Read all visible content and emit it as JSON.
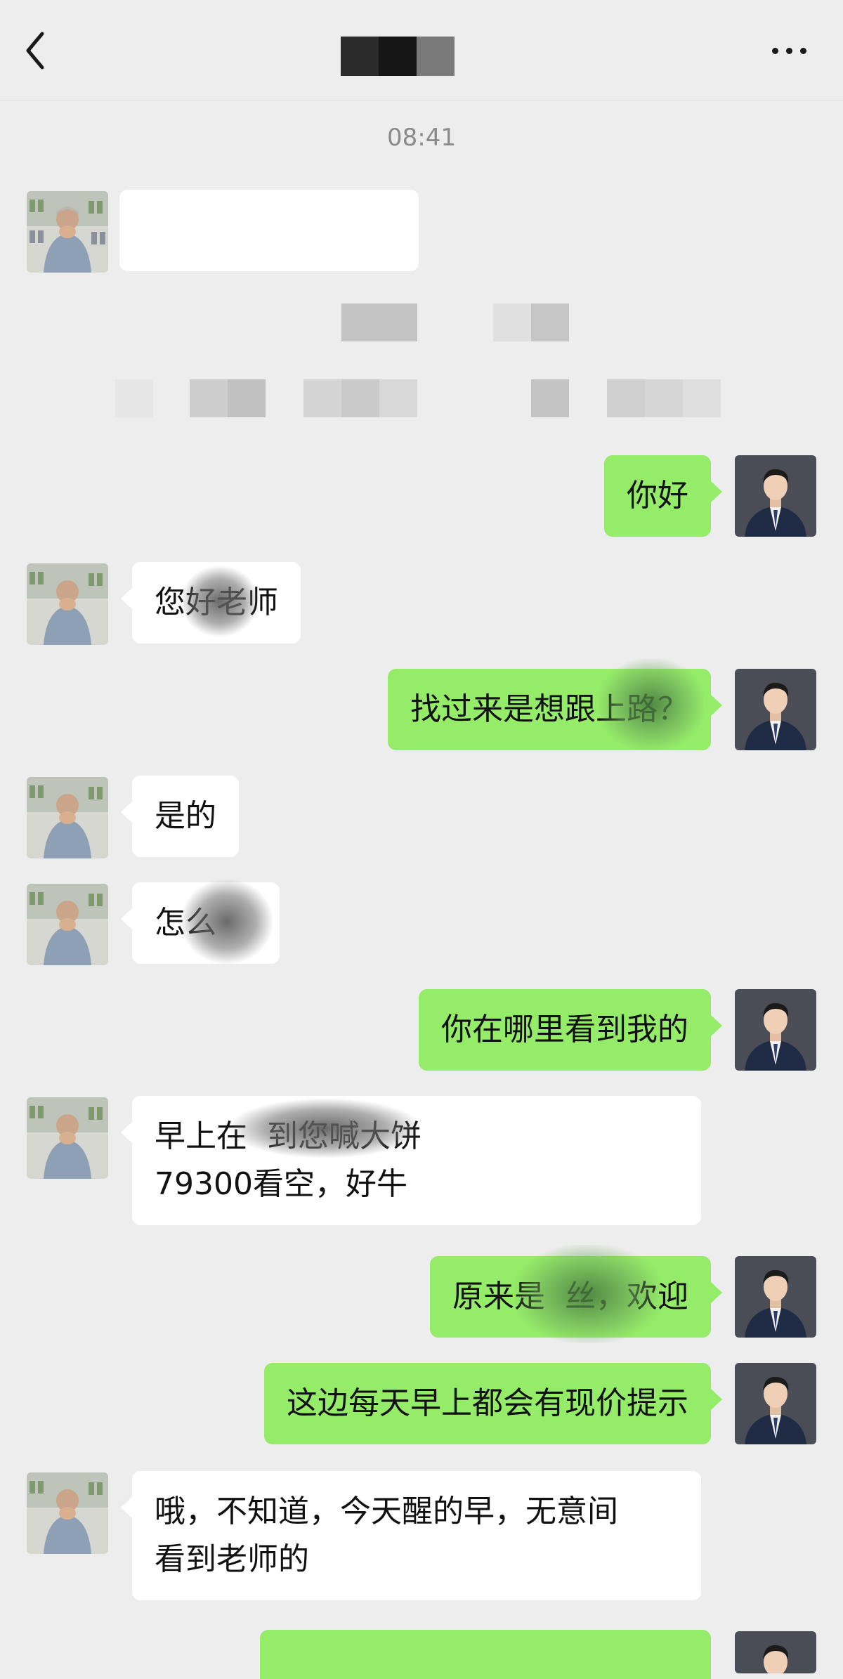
{
  "header": {
    "back_icon": "chevron-left-icon",
    "more_icon": "more-dots-icon"
  },
  "timestamp": "08:41",
  "messages": [
    {
      "side": "in",
      "text": "您好老师"
    },
    {
      "side": "out",
      "text": "你好"
    },
    {
      "side": "out",
      "text": "找过来是想跟上路？"
    },
    {
      "side": "in",
      "text": "是的"
    },
    {
      "side": "in",
      "text": "怎么"
    },
    {
      "side": "out",
      "text": "你在哪里看到我的"
    },
    {
      "side": "in",
      "line1": "早上在  到您喊大饼",
      "line2": "79300看空，好牛"
    },
    {
      "side": "out",
      "text": "原来是  丝，欢迎"
    },
    {
      "side": "out",
      "text": "这边每天早上都会有现价提示"
    },
    {
      "side": "in",
      "line1": "哦，不知道，今天醒的早，无意间",
      "line2": "看到老师的"
    }
  ],
  "colors": {
    "background": "#ededed",
    "incoming_bubble": "#ffffff",
    "outgoing_bubble": "#95ec69",
    "timestamp": "#8a8a8a"
  }
}
